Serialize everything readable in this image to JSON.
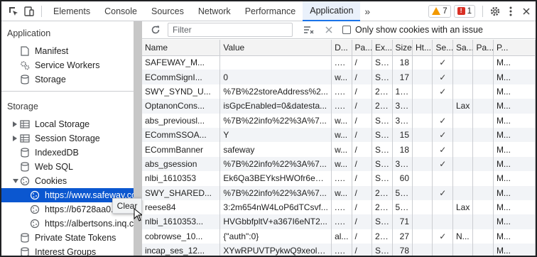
{
  "topbar": {
    "tabs": [
      "Elements",
      "Console",
      "Sources",
      "Network",
      "Performance",
      "Application"
    ],
    "active_tab": "Application",
    "more": "»",
    "warnings": "7",
    "errors": "1"
  },
  "sidebar": {
    "application_header": "Application",
    "application_items": [
      "Manifest",
      "Service Workers",
      "Storage"
    ],
    "storage_header": "Storage",
    "storage_items": [
      "Local Storage",
      "Session Storage",
      "IndexedDB",
      "Web SQL",
      "Cookies"
    ],
    "cookie_origins": [
      "https://www.safeway.com",
      "https://b6728aa0...",
      "https://albertsons.inq.com"
    ],
    "more_items": [
      "Private State Tokens",
      "Interest Groups"
    ]
  },
  "context_menu": {
    "clear_label": "Clear"
  },
  "toolbar": {
    "filter_placeholder": "Filter",
    "only_issue_label": "Only show cookies with an issue"
  },
  "table": {
    "columns": [
      "Name",
      "Value",
      "D...",
      "Pa...",
      "Ex...",
      "Size",
      "Ht...",
      "Se...",
      "Sa...",
      "Pa...",
      "P..."
    ],
    "rows": [
      [
        "SAFEWAY_M...",
        "",
        ".sa...",
        "/",
        "Se...",
        "18",
        "",
        "✓",
        "",
        "",
        "M..."
      ],
      [
        "ECommSignI...",
        "0",
        "w...",
        "/",
        "Se...",
        "17",
        "",
        "✓",
        "",
        "",
        "M..."
      ],
      [
        "SWY_SYND_U...",
        "%7B%22storeAddress%2...",
        ".sa...",
        "/",
        "20...",
        "142",
        "",
        "✓",
        "",
        "",
        "M..."
      ],
      [
        "OptanonCons...",
        "isGpcEnabled=0&datesta...",
        ".w...",
        "/",
        "20...",
        "351",
        "",
        "",
        "Lax",
        "",
        "M..."
      ],
      [
        "abs_previousl...",
        "%7B%22info%22%3A%7...",
        "w...",
        "/",
        "Se...",
        "368",
        "",
        "✓",
        "",
        "",
        "M..."
      ],
      [
        "ECommSSOA...",
        "Y",
        "w...",
        "/",
        "Se...",
        "15",
        "",
        "✓",
        "",
        "",
        "M..."
      ],
      [
        "ECommBanner",
        "safeway",
        "w...",
        "/",
        "Se...",
        "18",
        "",
        "✓",
        "",
        "",
        "M..."
      ],
      [
        "abs_gsession",
        "%7B%22info%22%3A%7...",
        "w...",
        "/",
        "Se...",
        "363",
        "",
        "✓",
        "",
        "",
        "M..."
      ],
      [
        "nlbi_1610353",
        "Ek6Qa3BEYksHWOfr6eN...",
        ".sa...",
        "/",
        "Se...",
        "60",
        "",
        "",
        "",
        "",
        "M..."
      ],
      [
        "SWY_SHARED...",
        "%7B%22info%22%3A%7...",
        "w...",
        "/",
        "20...",
        "550",
        "",
        "✓",
        "",
        "",
        "M..."
      ],
      [
        "reese84",
        "3:2m654nW4LoP6dTCsvf...",
        ".sa...",
        "/",
        "20...",
        "551",
        "",
        "",
        "Lax",
        "",
        "M..."
      ],
      [
        "nlbi_1610353...",
        "HVGbbfpltV+a367I6eNT2...",
        ".sa...",
        "/",
        "Se...",
        "71",
        "",
        "",
        "",
        "",
        "M..."
      ],
      [
        "cobrowse_10...",
        "{\"auth\":0}",
        "al...",
        "/",
        "20...",
        "27",
        "",
        "✓",
        "N...",
        "",
        "M..."
      ],
      [
        "incap_ses_12...",
        "XYwRPUVTPykwQ9xeolL8...",
        ".sa...",
        "/",
        "Se...",
        "78",
        "",
        "",
        "",
        "",
        "M..."
      ]
    ]
  }
}
